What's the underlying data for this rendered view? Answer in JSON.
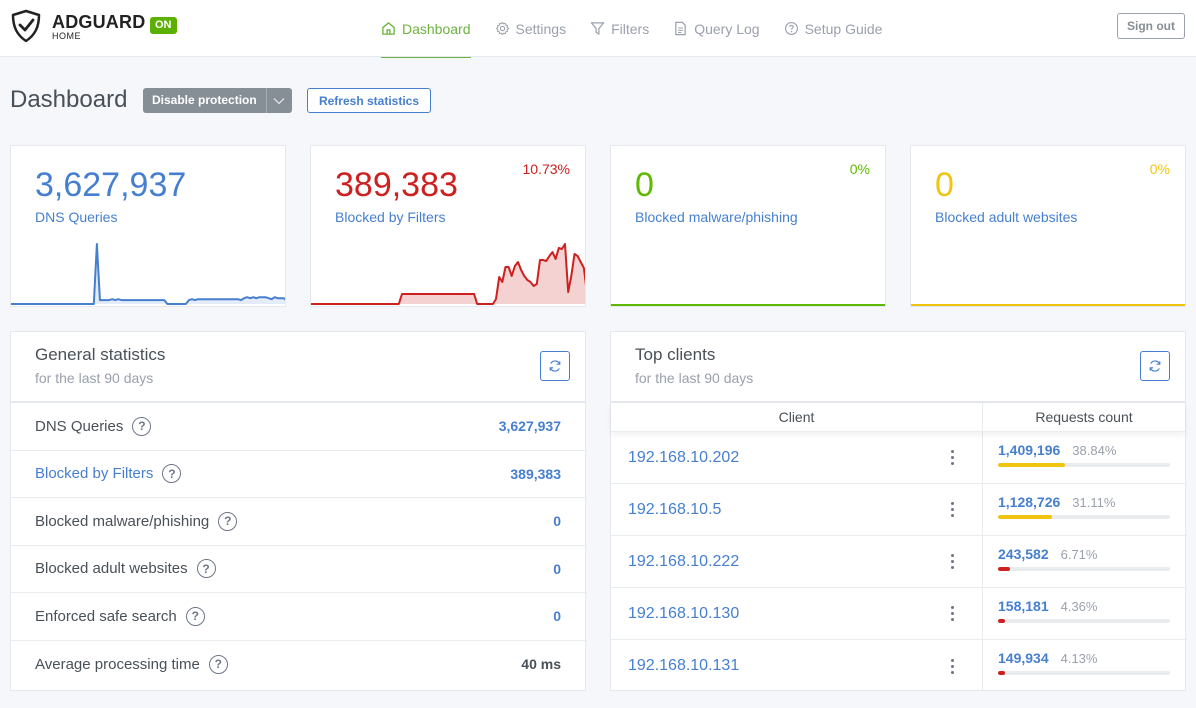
{
  "header": {
    "logo_title": "ADGUARD",
    "logo_sub": "HOME",
    "status_badge": "ON",
    "nav": [
      {
        "label": "Dashboard",
        "icon": "home-icon",
        "active": true
      },
      {
        "label": "Settings",
        "icon": "gear-icon",
        "active": false
      },
      {
        "label": "Filters",
        "icon": "filter-icon",
        "active": false
      },
      {
        "label": "Query Log",
        "icon": "document-icon",
        "active": false
      },
      {
        "label": "Setup Guide",
        "icon": "help-circle-icon",
        "active": false
      }
    ],
    "sign_out": "Sign out"
  },
  "page": {
    "title": "Dashboard",
    "disable_protection": "Disable protection",
    "refresh_statistics": "Refresh statistics"
  },
  "stats": [
    {
      "value": "3,627,937",
      "label": "DNS Queries",
      "percent": "",
      "color": "#467fcf",
      "sparkline": [
        0,
        0,
        0,
        0,
        0,
        0,
        0,
        0,
        0,
        0,
        0,
        0,
        0,
        0,
        0,
        0,
        0,
        0,
        0,
        0,
        0,
        0,
        0,
        0,
        0,
        0,
        0,
        0,
        62,
        4,
        4,
        4,
        4,
        5,
        4,
        5,
        4,
        4,
        4,
        4,
        4,
        4,
        4,
        4,
        4,
        4,
        4,
        4,
        4,
        4,
        4,
        0,
        0,
        0,
        0,
        0,
        0,
        0,
        4,
        5,
        4,
        5,
        5,
        5,
        5,
        5,
        5,
        5,
        5,
        5,
        5,
        5,
        5,
        5,
        5,
        4,
        6,
        7,
        6,
        7,
        6,
        7,
        7,
        7,
        6,
        5,
        7,
        6,
        6,
        6,
        3
      ]
    },
    {
      "value": "389,383",
      "label": "Blocked by Filters",
      "percent": "10.73%",
      "color": "#cd201f",
      "sparkline": [
        0,
        0,
        0,
        0,
        0,
        0,
        0,
        0,
        0,
        0,
        0,
        0,
        0,
        0,
        0,
        0,
        0,
        0,
        0,
        0,
        0,
        0,
        0,
        0,
        0,
        0,
        0,
        0,
        0,
        10,
        10,
        10,
        10,
        10,
        10,
        10,
        10,
        10,
        10,
        10,
        10,
        10,
        10,
        10,
        10,
        10,
        10,
        10,
        10,
        10,
        10,
        10,
        10,
        0,
        0,
        0,
        0,
        0,
        0,
        5,
        27,
        22,
        37,
        37,
        28,
        38,
        42,
        34,
        28,
        24,
        22,
        18,
        20,
        44,
        44,
        43,
        48,
        52,
        45,
        56,
        55,
        60,
        12,
        28,
        50,
        48,
        42,
        36,
        10
      ]
    },
    {
      "value": "0",
      "label": "Blocked malware/phishing",
      "percent": "0%",
      "color": "#5eba00",
      "sparkline": []
    },
    {
      "value": "0",
      "label": "Blocked adult websites",
      "percent": "0%",
      "color": "#f1c40f",
      "sparkline": []
    }
  ],
  "general_statistics": {
    "title": "General statistics",
    "subtitle": "for the last 90 days",
    "rows": [
      {
        "label": "DNS Queries",
        "value": "3,627,937",
        "link": false,
        "value_dark": false
      },
      {
        "label": "Blocked by Filters",
        "value": "389,383",
        "link": true,
        "value_dark": false
      },
      {
        "label": "Blocked malware/phishing",
        "value": "0",
        "link": false,
        "value_dark": false
      },
      {
        "label": "Blocked adult websites",
        "value": "0",
        "link": false,
        "value_dark": false
      },
      {
        "label": "Enforced safe search",
        "value": "0",
        "link": false,
        "value_dark": false
      },
      {
        "label": "Average processing time",
        "value": "40 ms",
        "link": false,
        "value_dark": true
      }
    ],
    "help_glyph": "?"
  },
  "top_clients": {
    "title": "Top clients",
    "subtitle": "for the last 90 days",
    "col_client": "Client",
    "col_requests": "Requests count",
    "rows": [
      {
        "ip": "192.168.10.202",
        "count": "1,409,196",
        "percent": "38.84%",
        "share": 38.84,
        "bar_color": "#f1c40f"
      },
      {
        "ip": "192.168.10.5",
        "count": "1,128,726",
        "percent": "31.11%",
        "share": 31.11,
        "bar_color": "#f1c40f"
      },
      {
        "ip": "192.168.10.222",
        "count": "243,582",
        "percent": "6.71%",
        "share": 6.71,
        "bar_color": "#cd201f"
      },
      {
        "ip": "192.168.10.130",
        "count": "158,181",
        "percent": "4.36%",
        "share": 4.36,
        "bar_color": "#cd201f"
      },
      {
        "ip": "192.168.10.131",
        "count": "149,934",
        "percent": "4.13%",
        "share": 4.13,
        "bar_color": "#cd201f"
      }
    ]
  }
}
